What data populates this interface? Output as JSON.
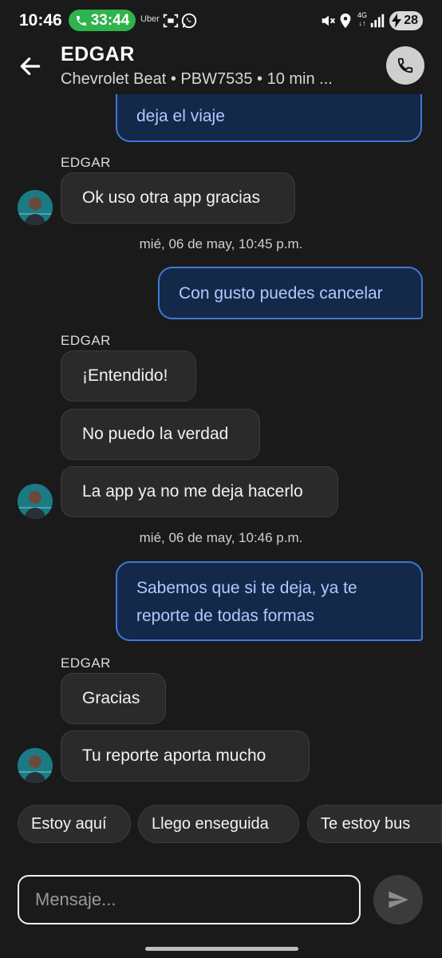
{
  "status_bar": {
    "time": "10:46",
    "call_timer": "33:44",
    "app_label": "Uber",
    "network": "4G",
    "battery": "28"
  },
  "header": {
    "name": "EDGAR",
    "subtitle": "Chevrolet Beat • PBW7535 • 10 min ..."
  },
  "messages": {
    "top_out": "deja el viaje",
    "g1_sender": "EDGAR",
    "g1_m1": "Ok uso otra app gracias",
    "ts1": "mié, 06 de may, 10:45 p.m.",
    "out1": "Con gusto puedes cancelar",
    "g2_sender": "EDGAR",
    "g2_m1": "¡Entendido!",
    "g2_m2": "No puedo la verdad",
    "g2_m3": "La app ya no me deja hacerlo",
    "ts2": "mié, 06 de may, 10:46 p.m.",
    "out2_l1": "Sabemos que si te deja, ya te",
    "out2_l2": "reporte de todas formas",
    "g3_sender": "EDGAR",
    "g3_m1": "Gracias",
    "g3_m2": "Tu reporte aporta mucho"
  },
  "quick_replies": [
    "Estoy aquí",
    "Llego enseguida",
    "Te estoy bus"
  ],
  "composer": {
    "placeholder": "Mensaje..."
  },
  "colors": {
    "outgoing_border": "#3f78d6",
    "outgoing_bg": "#14284a",
    "call_pill": "#2fb34d"
  }
}
